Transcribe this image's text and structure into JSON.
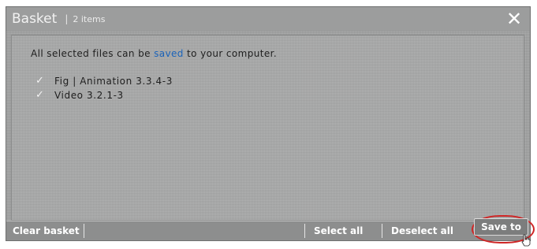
{
  "window": {
    "title": "Basket",
    "separator": "|",
    "item_count": "2 items",
    "close_icon": "close-icon"
  },
  "content": {
    "info_prefix": "All selected files can be",
    "info_link": "saved",
    "info_suffix": "to your computer.",
    "files": [
      {
        "label": "Fig | Animation 3.3.4-3",
        "checked": true
      },
      {
        "label": "Video 3.2.1-3",
        "checked": true
      }
    ]
  },
  "toolbar": {
    "clear_label": "Clear basket",
    "select_all_label": "Select all",
    "deselect_all_label": "Deselect all",
    "save_label": "Save to"
  },
  "colors": {
    "link": "#1a62b8",
    "highlight": "#cf2626"
  }
}
